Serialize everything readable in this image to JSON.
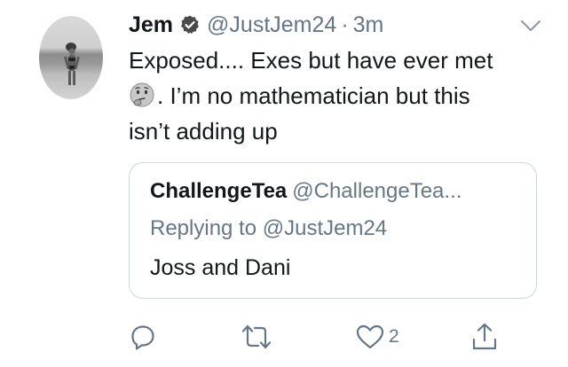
{
  "tweet": {
    "author_name": "Jem",
    "author_handle": "@JustJem24",
    "separator": "·",
    "timestamp": "3m",
    "text_line_1": "Exposed.... Exes but have ever met",
    "text_line_2": ". I’m no mathematician but this",
    "text_line_3": "isn’t adding up",
    "emoji": "thinking-face"
  },
  "quoted_tweet": {
    "author_name": "ChallengeTea",
    "author_handle": "@ChallengeTea...",
    "replying_to": "Replying to @JustJem24",
    "text": "Joss and Dani"
  },
  "actions": {
    "reply_icon": "reply-icon",
    "retweet_icon": "retweet-icon",
    "like_icon": "heart-icon",
    "like_count": "2",
    "share_icon": "share-icon"
  },
  "colors": {
    "text_primary": "#14171a",
    "text_secondary": "#657786",
    "border": "#ccd6dd"
  }
}
